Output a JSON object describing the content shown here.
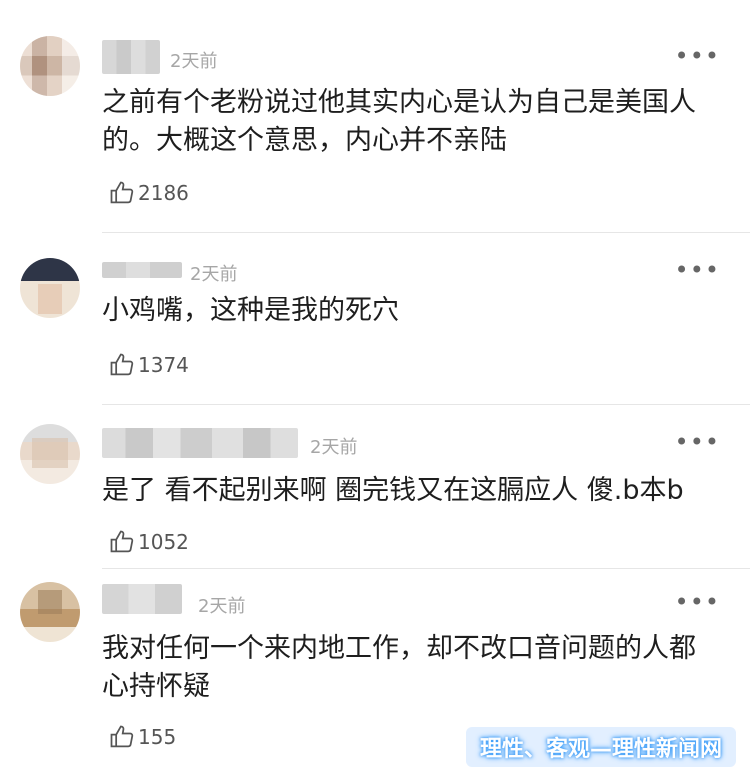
{
  "comments": [
    {
      "time": "2天前",
      "text": "之前有个老粉说过他其实内心是认为自己是美国人的。大概这个意思，内心并不亲陆",
      "likes": "2186"
    },
    {
      "time": "2天前",
      "text": "小鸡嘴，这种是我的死穴",
      "likes": "1374"
    },
    {
      "time": "2天前",
      "text": "是了 看不起别来啊 圈完钱又在这膈应人 傻.b本b",
      "likes": "1052"
    },
    {
      "time": "2天前",
      "text": "我对任何一个来内地工作，却不改口音问题的人都心持怀疑",
      "likes": "155"
    }
  ],
  "more_label": "•••",
  "watermark": "理性、客观—理性新闻网",
  "icons": {
    "like": "thumbs-up-icon",
    "more": "more-dots-icon"
  }
}
